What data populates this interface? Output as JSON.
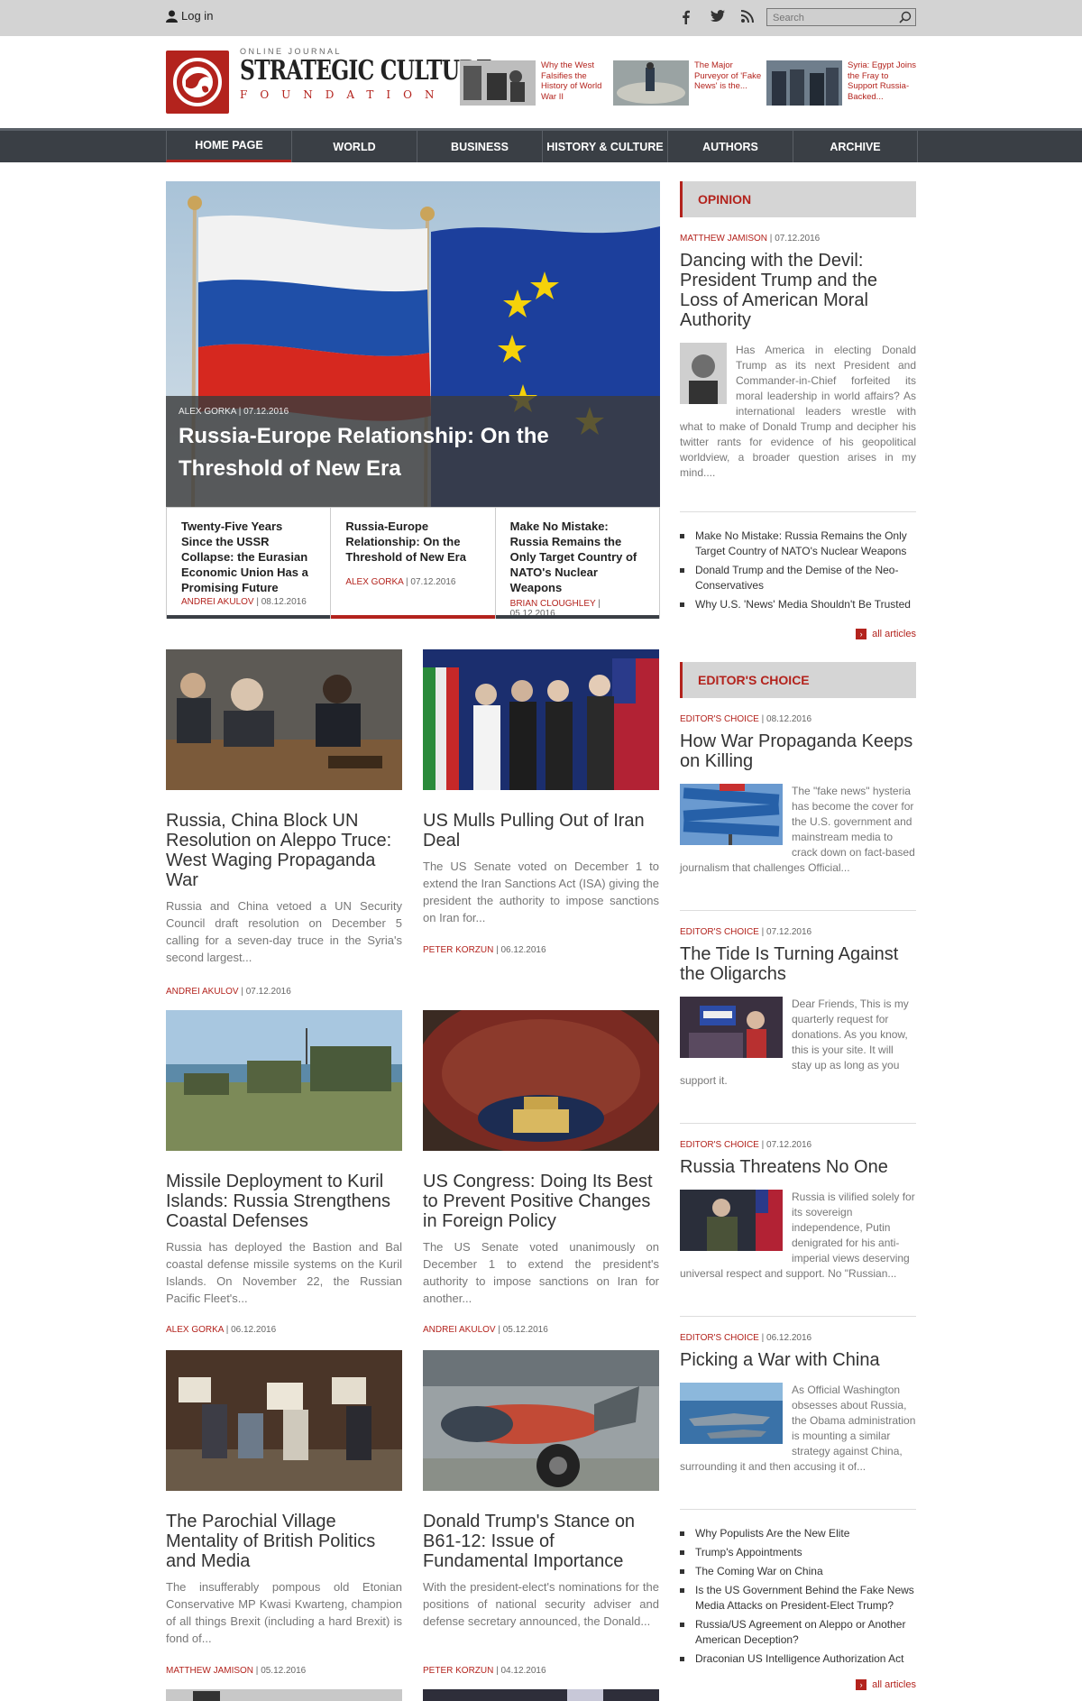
{
  "topbar": {
    "login": "Log in",
    "search_placeholder": "Search"
  },
  "brand": {
    "small": "ONLINE JOURNAL",
    "title": "STRATEGIC CULTURE",
    "sub": "FOUNDATION"
  },
  "promos": [
    {
      "text": "Why the West Falsifies the History of World War II"
    },
    {
      "text": "The Major Purveyor of 'Fake News' is the..."
    },
    {
      "text": "Syria: Egypt Joins the Fray to Support Russia-Backed..."
    }
  ],
  "nav": [
    "HOME PAGE",
    "WORLD",
    "BUSINESS",
    "HISTORY & CULTURE",
    "AUTHORS",
    "ARCHIVE"
  ],
  "hero": {
    "author": "ALEX GORKA",
    "date": "07.12.2016",
    "title": "Russia-Europe Relationship: On the Threshold of New Era"
  },
  "subs": [
    {
      "title": "Twenty-Five Years Since the USSR Collapse: the Eurasian Economic Union Has a Promising Future",
      "author": "ANDREI AKULOV",
      "date": "08.12.2016"
    },
    {
      "title": "Russia-Europe Relationship: On the Threshold of New Era",
      "author": "ALEX GORKA",
      "date": "07.12.2016"
    },
    {
      "title": "Make No Mistake: Russia Remains the Only Target Country of NATO's Nuclear Weapons",
      "author": "BRIAN CLOUGHLEY",
      "date": "05.12.2016"
    }
  ],
  "articles": [
    {
      "title": "Russia, China Block UN Resolution on Aleppo Truce: West Waging Propaganda War",
      "excerpt": "Russia and China vetoed a UN Security Council draft resolution on December 5 calling for a seven-day truce in the Syria's second largest...",
      "author": "ANDREI AKULOV",
      "date": "07.12.2016"
    },
    {
      "title": "US Mulls Pulling Out of Iran Deal",
      "excerpt": "The US Senate voted on December 1 to extend the Iran Sanctions Act (ISA) giving the president the authority to impose sanctions on Iran for...",
      "author": "PETER KORZUN",
      "date": "06.12.2016"
    },
    {
      "title": "Missile Deployment to Kuril Islands: Russia Strengthens Coastal Defenses",
      "excerpt": "Russia has deployed the Bastion and Bal coastal defense missile systems on the Kuril Islands. On November 22, the Russian Pacific Fleet's...",
      "author": "ALEX GORKA",
      "date": "06.12.2016"
    },
    {
      "title": "US Congress: Doing Its Best to Prevent Positive Changes in Foreign Policy",
      "excerpt": "The US Senate voted unanimously on December 1 to extend the president's authority to impose sanctions on Iran for another...",
      "author": "ANDREI AKULOV",
      "date": "05.12.2016"
    },
    {
      "title": "The Parochial Village Mentality of British Politics and Media",
      "excerpt": "The insufferably pompous old Etonian Conservative MP Kwasi Kwarteng, champion of all things Brexit (including a hard Brexit) is fond of...",
      "author": "MATTHEW JAMISON",
      "date": "05.12.2016"
    },
    {
      "title": "Donald Trump's Stance on B61-12: Issue of Fundamental Importance",
      "excerpt": "With the president-elect's nominations for the positions of national security adviser and defense secretary announced, the Donald...",
      "author": "PETER KORZUN",
      "date": "04.12.2016"
    }
  ],
  "opinion": {
    "header": "OPINION",
    "author": "MATTHEW JAMISON",
    "date": "07.12.2016",
    "title": "Dancing with the Devil: President Trump and the Loss of American Moral Authority",
    "excerpt": "Has America in electing Donald Trump as its next President and Commander-in-Chief forfeited its moral leadership in world affairs? As international leaders wrestle with what to make of Donald Trump and decipher his twitter rants for evidence of his geopolitical worldview, a broader question arises in my mind....",
    "links": [
      "Make No Mistake: Russia Remains the Only Target Country of NATO's Nuclear Weapons",
      "Donald Trump and the Demise of the Neo-Conservatives",
      "Why U.S. 'News' Media Shouldn't Be Trusted"
    ],
    "all": "all articles"
  },
  "editors": {
    "header": "EDITOR'S CHOICE",
    "label": "EDITOR'S CHOICE",
    "items": [
      {
        "date": "08.12.2016",
        "title": "How War Propaganda Keeps on Killing",
        "excerpt": "The \"fake news\" hysteria has become the cover for the U.S. government and mainstream media to crack down on fact-based journalism that challenges Official..."
      },
      {
        "date": "07.12.2016",
        "title": "The Tide Is Turning Against the Oligarchs",
        "excerpt": "Dear Friends, This is my quarterly request for donations. As you know, this is your site. It will stay up as long as you support it."
      },
      {
        "date": "07.12.2016",
        "title": "Russia Threatens No One",
        "excerpt": "Russia is vilified solely for its sovereign independence, Putin denigrated for his anti-imperial views deserving universal respect and support. No \"Russian..."
      },
      {
        "date": "06.12.2016",
        "title": "Picking a War with China",
        "excerpt": "As Official Washington obsesses about Russia, the Obama administration is mounting a similar strategy against China, surrounding it and then accusing it of..."
      }
    ],
    "links": [
      "Why Populists Are the New Elite",
      "Trump's Appointments",
      "The Coming War on China",
      "Is the US Government Behind the Fake News Media Attacks on President-Elect Trump?",
      "Russia/US Agreement on Aleppo or Another American Deception?",
      "Draconian US Intelligence Authorization Act"
    ],
    "all": "all articles"
  }
}
